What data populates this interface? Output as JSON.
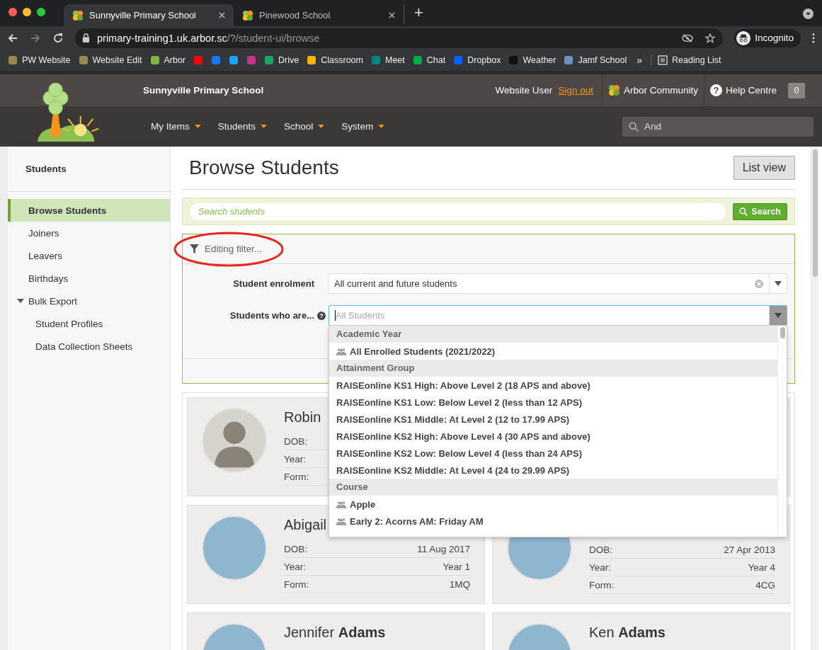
{
  "browser": {
    "tabs": [
      {
        "title": "Sunnyville Primary School",
        "selected": true
      },
      {
        "title": "Pinewood School",
        "selected": false
      }
    ],
    "new_tab": "+",
    "url_host": "primary-training1.uk.arbor.sc",
    "url_path": "/?/student-ui/browse",
    "profile": "Incognito",
    "bookmarks": [
      {
        "label": "PW Website",
        "color": "#9a8a4a"
      },
      {
        "label": "Website Edit",
        "color": "#9a8a4a"
      },
      {
        "label": "Arbor",
        "color": "#7cb342"
      },
      {
        "color": "#ff0000"
      },
      {
        "color": "#1877f2"
      },
      {
        "color": "#1da1f2"
      },
      {
        "color": "#c13584"
      },
      {
        "label": "Drive",
        "color": "#1fa463"
      },
      {
        "label": "Classroom",
        "color": "#f4b400"
      },
      {
        "label": "Meet",
        "color": "#00897b"
      },
      {
        "label": "Chat",
        "color": "#00ac47"
      },
      {
        "label": "Dropbox",
        "color": "#0061ff"
      },
      {
        "label": "Weather",
        "color": "#111111"
      },
      {
        "label": "Jamf School",
        "color": "#6f8fbf"
      }
    ],
    "more": "»",
    "reading_list": "Reading List"
  },
  "header": {
    "school_name": "Sunnyville Primary School",
    "user": "Website User",
    "sign_out": "Sign out",
    "community": "Arbor Community",
    "help_icon": "?",
    "help": "Help Centre",
    "notifications": "0",
    "menu": [
      {
        "label": "My Items"
      },
      {
        "label": "Students"
      },
      {
        "label": "School"
      },
      {
        "label": "System"
      }
    ],
    "search_value": "And"
  },
  "sidebar": {
    "heading": "Students",
    "items": [
      {
        "label": "Browse Students",
        "selected": true
      },
      {
        "label": "Joiners",
        "selected": false
      },
      {
        "label": "Leavers",
        "selected": false
      },
      {
        "label": "Birthdays",
        "selected": false
      },
      {
        "label": "Bulk Export",
        "selected": false,
        "expanded": true,
        "children": [
          {
            "label": "Student Profiles",
            "selected": false
          },
          {
            "label": "Data Collection Sheets",
            "selected": false
          }
        ]
      }
    ]
  },
  "main": {
    "title": "Browse Students",
    "list_view_button": "List view",
    "search": {
      "placeholder": "Search students",
      "button": "Search"
    },
    "filter": {
      "status": "Editing filter...",
      "annotation": {
        "kind": "ellipse"
      },
      "fields": [
        {
          "kind": "select",
          "label": "Student enrolment",
          "value": "All current and future students"
        },
        {
          "kind": "multiselect",
          "label": "Students who are...",
          "placeholder": "All Students",
          "help": "?",
          "focused": true
        }
      ],
      "dropdown": {
        "groups": [
          {
            "heading": "Academic Year",
            "items": [
              {
                "label": "All Enrolled Students (2021/2022)",
                "icon": true
              }
            ]
          },
          {
            "heading": "Attainment Group",
            "items": [
              {
                "label": "RAISEonline KS1 High: Above Level 2 (18 APS and above)",
                "icon": false
              },
              {
                "label": "RAISEonline KS1 Low: Below Level 2 (less than 12 APS)",
                "icon": false
              },
              {
                "label": "RAISEonline KS1 Middle: At Level 2 (12 to 17.99 APS)",
                "icon": false
              },
              {
                "label": "RAISEonline KS2 High: Above Level 4 (30 APS and above)",
                "icon": false
              },
              {
                "label": "RAISEonline KS2 Low: Below Level 4 (less than 24 APS)",
                "icon": false
              },
              {
                "label": "RAISEonline KS2 Middle: At Level 4 (24 to 29.99 APS)",
                "icon": false
              }
            ]
          },
          {
            "heading": "Course",
            "items": [
              {
                "label": "Apple",
                "icon": true
              },
              {
                "label": "Early 2: Acorns AM: Friday AM",
                "icon": true
              }
            ]
          }
        ]
      }
    },
    "students": [
      {
        "name": "Robin",
        "kind": "silhouette",
        "details": [
          {
            "label": "DOB:"
          },
          {
            "label": "Year:"
          },
          {
            "label": "Form:"
          }
        ]
      },
      {
        "kind": "blank"
      },
      {
        "name": "Abigail",
        "kind": "photo",
        "details": [
          {
            "label": "DOB:",
            "value": "11 Aug 2017"
          },
          {
            "label": "Year:",
            "value": "Year 1"
          },
          {
            "label": "Form:",
            "value": "1MQ"
          }
        ]
      },
      {
        "kind": "photo",
        "details": [
          {
            "label": "DOB:",
            "value": "27 Apr 2013"
          },
          {
            "label": "Year:",
            "value": "Year 4"
          },
          {
            "label": "Form:",
            "value": "4CG"
          }
        ]
      },
      {
        "name": "Jennifer **Adams**",
        "kind": "photo"
      },
      {
        "name": "Ken **Adams**",
        "kind": "photo"
      }
    ]
  }
}
